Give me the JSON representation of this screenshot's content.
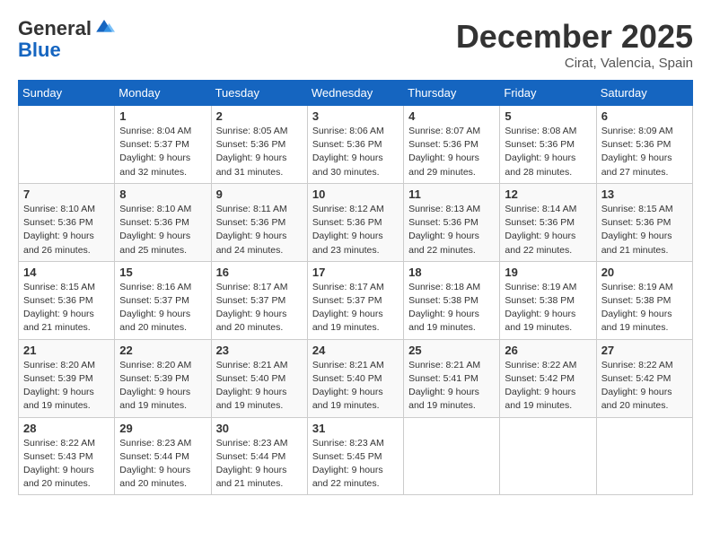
{
  "header": {
    "logo_general": "General",
    "logo_blue": "Blue",
    "month": "December 2025",
    "location": "Cirat, Valencia, Spain"
  },
  "days_of_week": [
    "Sunday",
    "Monday",
    "Tuesday",
    "Wednesday",
    "Thursday",
    "Friday",
    "Saturday"
  ],
  "weeks": [
    [
      {
        "day": "",
        "info": ""
      },
      {
        "day": "1",
        "info": "Sunrise: 8:04 AM\nSunset: 5:37 PM\nDaylight: 9 hours\nand 32 minutes."
      },
      {
        "day": "2",
        "info": "Sunrise: 8:05 AM\nSunset: 5:36 PM\nDaylight: 9 hours\nand 31 minutes."
      },
      {
        "day": "3",
        "info": "Sunrise: 8:06 AM\nSunset: 5:36 PM\nDaylight: 9 hours\nand 30 minutes."
      },
      {
        "day": "4",
        "info": "Sunrise: 8:07 AM\nSunset: 5:36 PM\nDaylight: 9 hours\nand 29 minutes."
      },
      {
        "day": "5",
        "info": "Sunrise: 8:08 AM\nSunset: 5:36 PM\nDaylight: 9 hours\nand 28 minutes."
      },
      {
        "day": "6",
        "info": "Sunrise: 8:09 AM\nSunset: 5:36 PM\nDaylight: 9 hours\nand 27 minutes."
      }
    ],
    [
      {
        "day": "7",
        "info": "Sunrise: 8:10 AM\nSunset: 5:36 PM\nDaylight: 9 hours\nand 26 minutes."
      },
      {
        "day": "8",
        "info": "Sunrise: 8:10 AM\nSunset: 5:36 PM\nDaylight: 9 hours\nand 25 minutes."
      },
      {
        "day": "9",
        "info": "Sunrise: 8:11 AM\nSunset: 5:36 PM\nDaylight: 9 hours\nand 24 minutes."
      },
      {
        "day": "10",
        "info": "Sunrise: 8:12 AM\nSunset: 5:36 PM\nDaylight: 9 hours\nand 23 minutes."
      },
      {
        "day": "11",
        "info": "Sunrise: 8:13 AM\nSunset: 5:36 PM\nDaylight: 9 hours\nand 22 minutes."
      },
      {
        "day": "12",
        "info": "Sunrise: 8:14 AM\nSunset: 5:36 PM\nDaylight: 9 hours\nand 22 minutes."
      },
      {
        "day": "13",
        "info": "Sunrise: 8:15 AM\nSunset: 5:36 PM\nDaylight: 9 hours\nand 21 minutes."
      }
    ],
    [
      {
        "day": "14",
        "info": "Sunrise: 8:15 AM\nSunset: 5:36 PM\nDaylight: 9 hours\nand 21 minutes."
      },
      {
        "day": "15",
        "info": "Sunrise: 8:16 AM\nSunset: 5:37 PM\nDaylight: 9 hours\nand 20 minutes."
      },
      {
        "day": "16",
        "info": "Sunrise: 8:17 AM\nSunset: 5:37 PM\nDaylight: 9 hours\nand 20 minutes."
      },
      {
        "day": "17",
        "info": "Sunrise: 8:17 AM\nSunset: 5:37 PM\nDaylight: 9 hours\nand 19 minutes."
      },
      {
        "day": "18",
        "info": "Sunrise: 8:18 AM\nSunset: 5:38 PM\nDaylight: 9 hours\nand 19 minutes."
      },
      {
        "day": "19",
        "info": "Sunrise: 8:19 AM\nSunset: 5:38 PM\nDaylight: 9 hours\nand 19 minutes."
      },
      {
        "day": "20",
        "info": "Sunrise: 8:19 AM\nSunset: 5:38 PM\nDaylight: 9 hours\nand 19 minutes."
      }
    ],
    [
      {
        "day": "21",
        "info": "Sunrise: 8:20 AM\nSunset: 5:39 PM\nDaylight: 9 hours\nand 19 minutes."
      },
      {
        "day": "22",
        "info": "Sunrise: 8:20 AM\nSunset: 5:39 PM\nDaylight: 9 hours\nand 19 minutes."
      },
      {
        "day": "23",
        "info": "Sunrise: 8:21 AM\nSunset: 5:40 PM\nDaylight: 9 hours\nand 19 minutes."
      },
      {
        "day": "24",
        "info": "Sunrise: 8:21 AM\nSunset: 5:40 PM\nDaylight: 9 hours\nand 19 minutes."
      },
      {
        "day": "25",
        "info": "Sunrise: 8:21 AM\nSunset: 5:41 PM\nDaylight: 9 hours\nand 19 minutes."
      },
      {
        "day": "26",
        "info": "Sunrise: 8:22 AM\nSunset: 5:42 PM\nDaylight: 9 hours\nand 19 minutes."
      },
      {
        "day": "27",
        "info": "Sunrise: 8:22 AM\nSunset: 5:42 PM\nDaylight: 9 hours\nand 20 minutes."
      }
    ],
    [
      {
        "day": "28",
        "info": "Sunrise: 8:22 AM\nSunset: 5:43 PM\nDaylight: 9 hours\nand 20 minutes."
      },
      {
        "day": "29",
        "info": "Sunrise: 8:23 AM\nSunset: 5:44 PM\nDaylight: 9 hours\nand 20 minutes."
      },
      {
        "day": "30",
        "info": "Sunrise: 8:23 AM\nSunset: 5:44 PM\nDaylight: 9 hours\nand 21 minutes."
      },
      {
        "day": "31",
        "info": "Sunrise: 8:23 AM\nSunset: 5:45 PM\nDaylight: 9 hours\nand 22 minutes."
      },
      {
        "day": "",
        "info": ""
      },
      {
        "day": "",
        "info": ""
      },
      {
        "day": "",
        "info": ""
      }
    ]
  ]
}
